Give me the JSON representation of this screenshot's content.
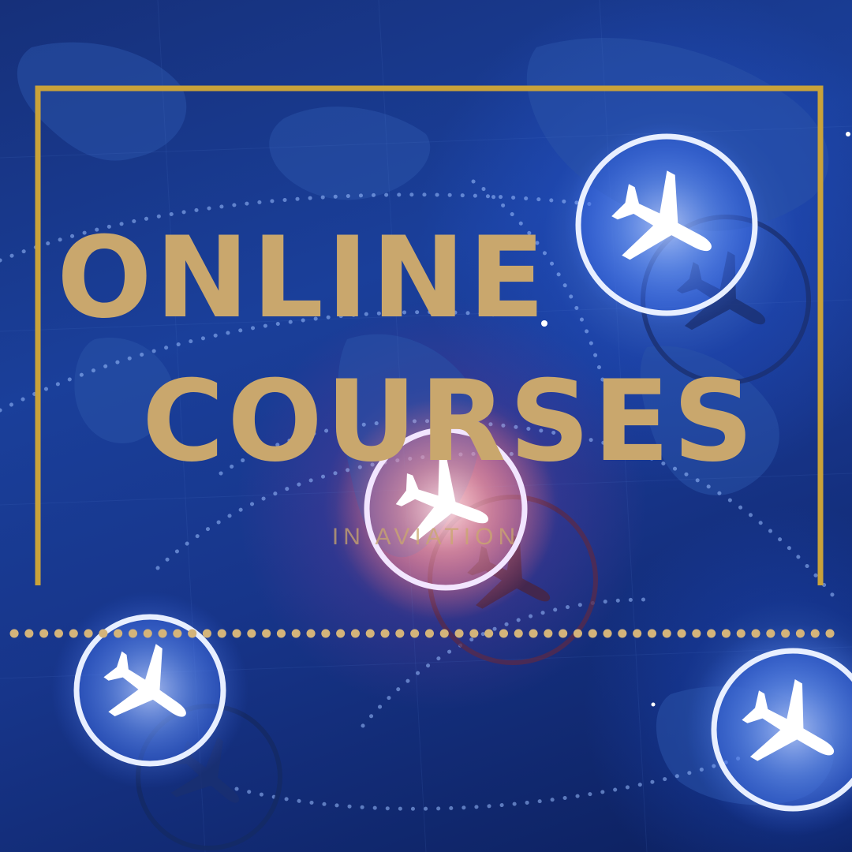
{
  "headline": {
    "line1": "ONLINE",
    "line2": "COURSES",
    "subtitle": "IN AVIATION"
  },
  "colors": {
    "gold": "#c9a76d",
    "frame_gold": "#c9a23a",
    "background_blue": "#1a3f9a",
    "glow_pink": "#f08c8c"
  },
  "icons": [
    "airplane-icon",
    "world-map",
    "flight-path"
  ]
}
